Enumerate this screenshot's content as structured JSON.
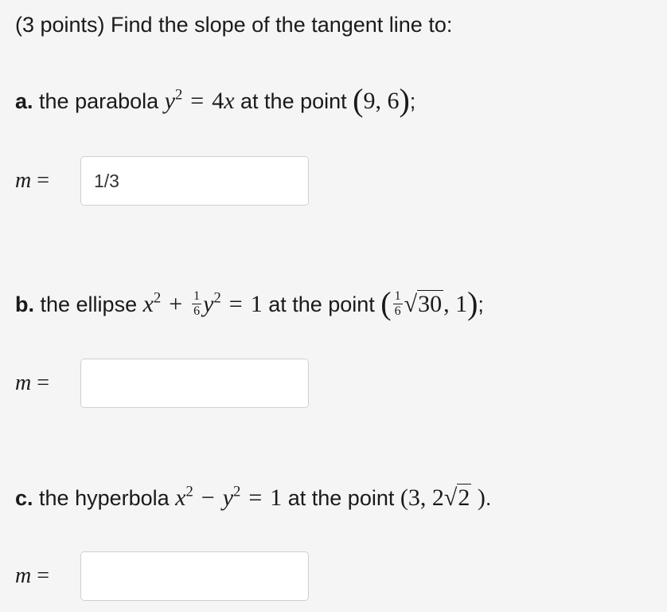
{
  "header": {
    "title": "(3 points) Find the slope of the tangent line to:"
  },
  "parts": [
    {
      "letter": "a.",
      "desc": " the parabola ",
      "curve_lhs_var": "y",
      "curve_lhs_exp": "2",
      "equals": "=",
      "rhs_coef": "4",
      "rhs_var": "x",
      "point_label": " at the point ",
      "point_x": "9",
      "point_y": "6",
      "trailing": ";",
      "m_var": "m",
      "m_equals": "=",
      "answer_value": "1/3"
    },
    {
      "letter": "b.",
      "desc": " the ellipse ",
      "var_x": "x",
      "exp_x": "2",
      "plus": "+",
      "frac_num": "1",
      "frac_den": "6",
      "var_y": "y",
      "exp_y": "2",
      "equals": "=",
      "rhs": "1",
      "point_label": " at the point ",
      "pt_frac_num": "1",
      "pt_frac_den": "6",
      "pt_radicand": "30",
      "pt_y": "1",
      "trailing": ";",
      "m_var": "m",
      "m_equals": "=",
      "answer_value": ""
    },
    {
      "letter": "c.",
      "desc": " the hyperbola ",
      "var_x": "x",
      "exp_x": "2",
      "minus": "−",
      "var_y": "y",
      "exp_y": "2",
      "equals": "=",
      "rhs": "1",
      "point_label": " at the point ",
      "pt_x": "3",
      "pt_coef": "2",
      "pt_radicand": "2",
      "trailing": ".",
      "m_var": "m",
      "m_equals": "=",
      "answer_value": ""
    }
  ],
  "icons": {
    "palette": "grid-icon"
  }
}
